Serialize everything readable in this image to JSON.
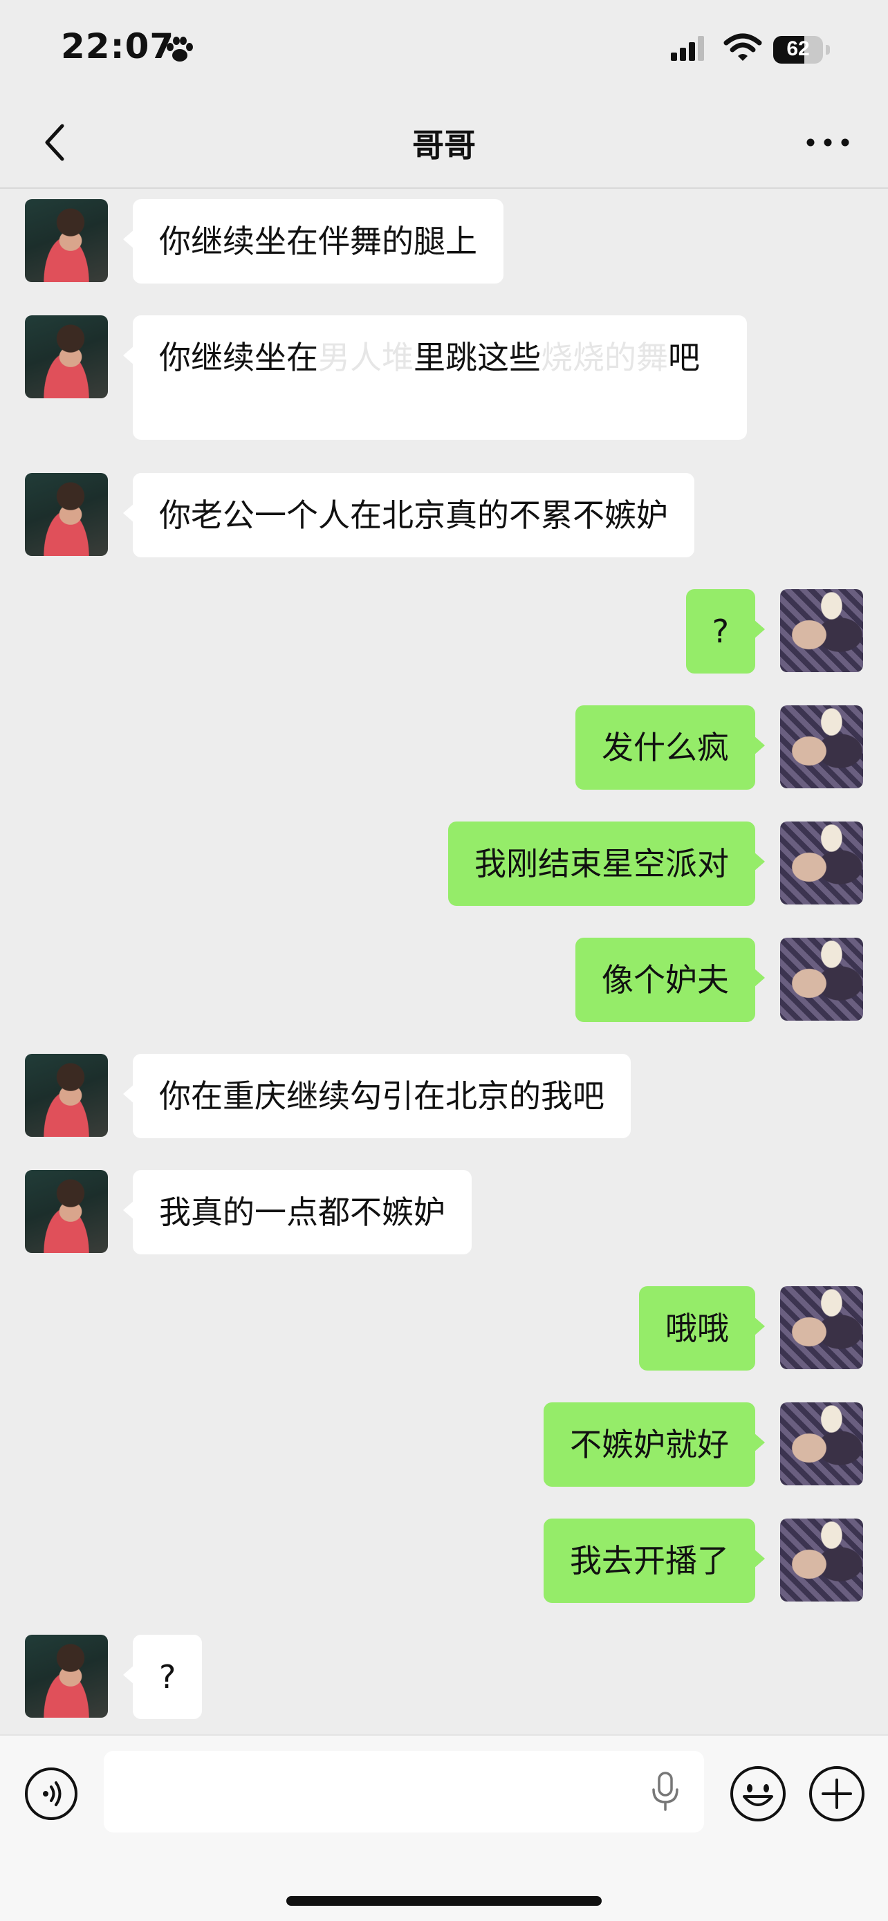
{
  "status_bar": {
    "time": "22:07",
    "battery_percent": "62",
    "battery_level": 0.62
  },
  "nav": {
    "title": "哥哥"
  },
  "messages": [
    {
      "side": "left",
      "text": "你继续坐在伴舞的腿上"
    },
    {
      "side": "left",
      "segments": [
        {
          "text": "你继续坐在",
          "faded": false
        },
        {
          "text": "男人堆",
          "faded": true
        },
        {
          "text": "里跳这些",
          "faded": false
        },
        {
          "text": "烧烧的舞",
          "faded": true
        },
        {
          "text": "吧",
          "faded": false
        }
      ]
    },
    {
      "side": "left",
      "text": "你老公一个人在北京真的不累不嫉妒"
    },
    {
      "side": "right",
      "text": "?"
    },
    {
      "side": "right",
      "text": "发什么疯"
    },
    {
      "side": "right",
      "text": "我刚结束星空派对"
    },
    {
      "side": "right",
      "text": "像个妒夫"
    },
    {
      "side": "left",
      "text": "你在重庆继续勾引在北京的我吧"
    },
    {
      "side": "left",
      "text": "我真的一点都不嫉妒"
    },
    {
      "side": "right",
      "text": "哦哦"
    },
    {
      "side": "right",
      "text": "不嫉妒就好"
    },
    {
      "side": "right",
      "text": "我去开播了"
    },
    {
      "side": "left",
      "text": "?"
    }
  ],
  "colors": {
    "background": "#ededed",
    "bubble_self": "#95ec69",
    "bubble_other": "#ffffff"
  },
  "icons": {
    "status": [
      "paw-icon",
      "signal-icon",
      "wifi-icon",
      "battery-icon"
    ],
    "nav": [
      "back-icon",
      "more-icon"
    ],
    "input": [
      "voice-icon",
      "mic-icon",
      "emoji-icon",
      "plus-icon"
    ]
  }
}
